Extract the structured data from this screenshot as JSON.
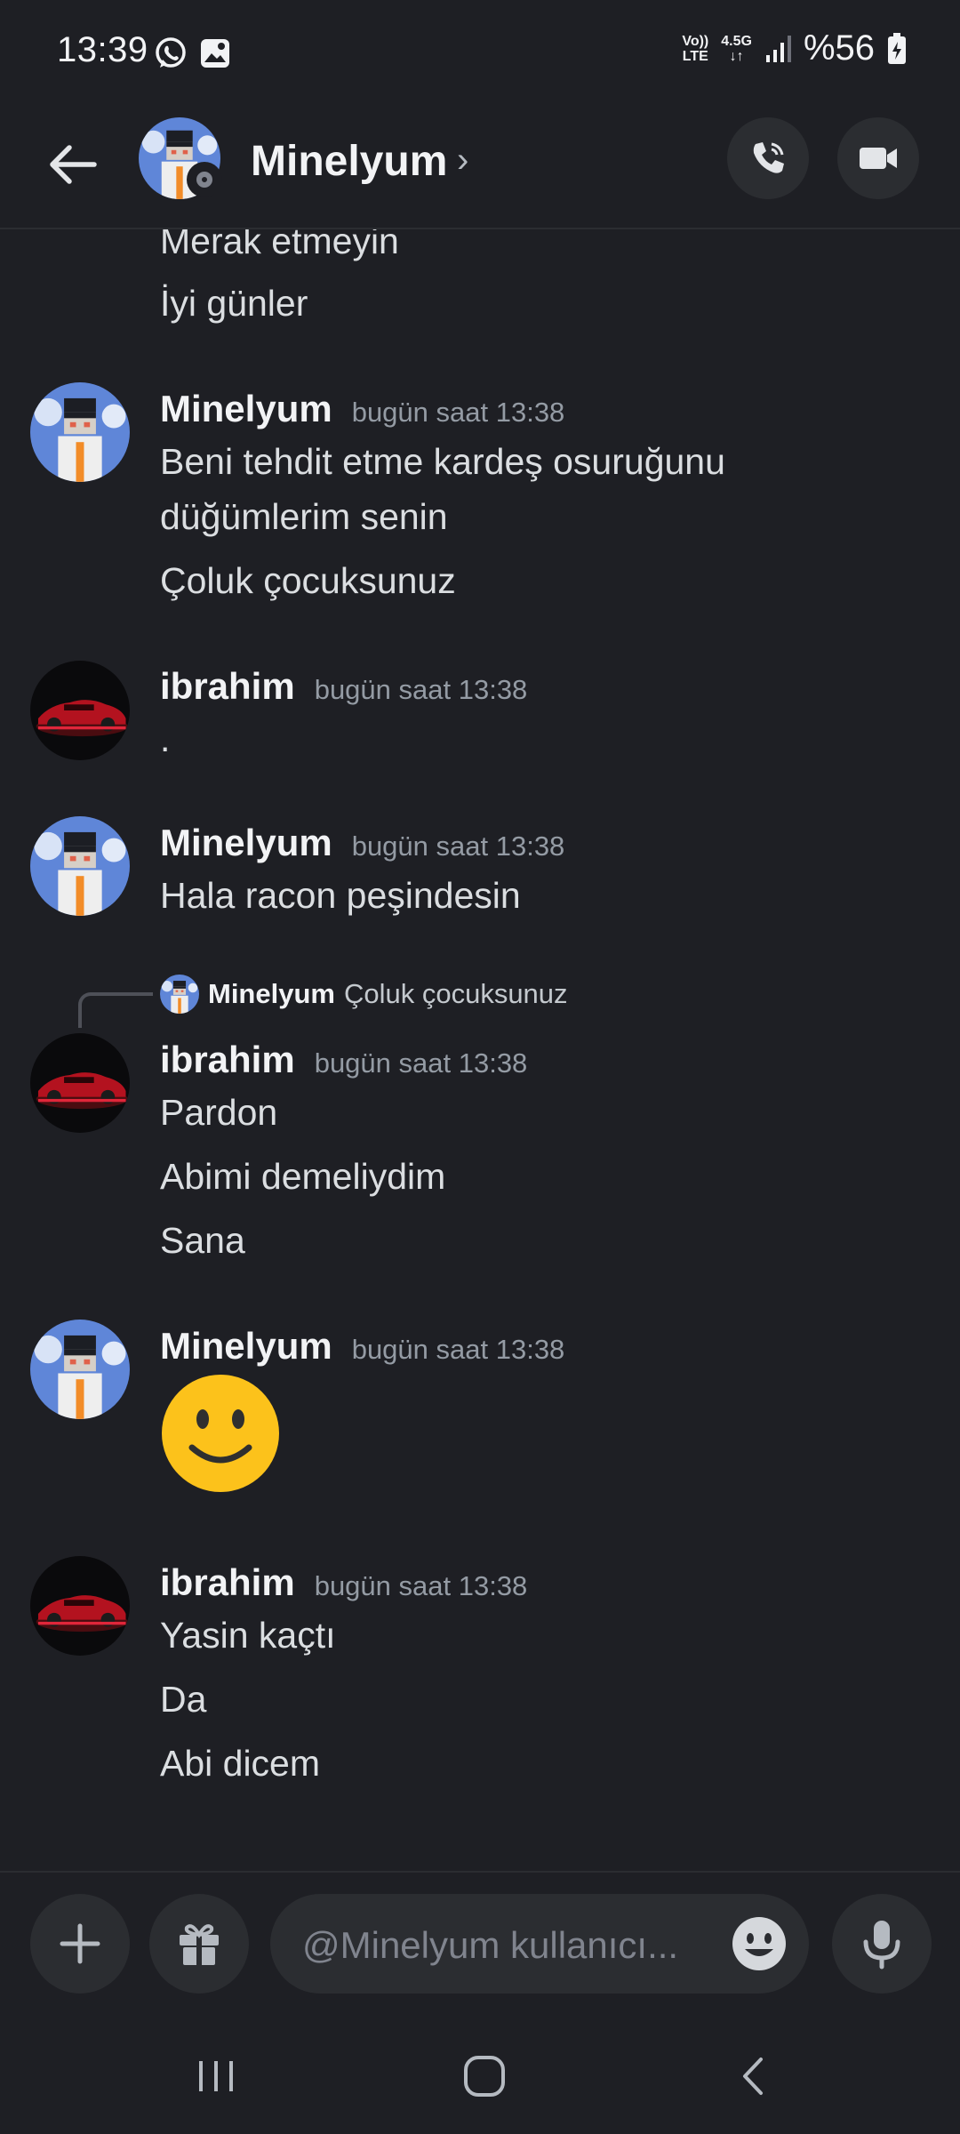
{
  "status_bar": {
    "time": "13:39",
    "icons": [
      "whatsapp-icon",
      "gallery-icon",
      "volte-icon",
      "signal-icon"
    ],
    "net_volte": "Vo))\nLTE",
    "net_type": "4.5G",
    "battery": "%56"
  },
  "header": {
    "name": "Minelyum",
    "chevron": "›",
    "icons": [
      "back-arrow-icon",
      "phone-icon",
      "video-camera-icon"
    ]
  },
  "messages": {
    "prev_line1": "Merak etmeyin",
    "prev_line2": "İyi günler",
    "g1": {
      "author": "Minelyum",
      "time": "bugün saat 13:38",
      "line1": "Beni tehdit etme kardeş osuruğunu",
      "line2": "düğümlerim senin",
      "line3": "Çoluk çocuksunuz"
    },
    "g2": {
      "author": "ibrahim",
      "time": "bugün saat 13:38",
      "line1": "."
    },
    "g3": {
      "author": "Minelyum",
      "time": "bugün saat 13:38",
      "line1": "Hala racon peşindesin"
    },
    "g4": {
      "reply_author": "Minelyum",
      "reply_text": "Çoluk çocuksunuz",
      "author": "ibrahim",
      "time": "bugün saat 13:38",
      "line1": "Pardon",
      "line2": "Abimi demeliydim",
      "line3": "Sana"
    },
    "g5": {
      "author": "Minelyum",
      "time": "bugün saat 13:38",
      "emoji": "slightly-smiling-face-emoji"
    },
    "g6": {
      "author": "ibrahim",
      "time": "bugün saat 13:38",
      "line1": "Yasin kaçtı",
      "line2": "Da",
      "line3": "Abi dicem"
    }
  },
  "composer": {
    "placeholder": "@Minelyum kullanıcı...",
    "icons": [
      "plus-icon",
      "gift-icon",
      "emoji-icon",
      "microphone-icon"
    ]
  },
  "nav_bar": {
    "icons": [
      "recent-apps-icon",
      "home-icon",
      "back-icon"
    ]
  },
  "colors": {
    "background": "#1e1f24",
    "surface": "#2b2d31",
    "text": "#dbdee1",
    "muted": "#949ba4",
    "emoji_yellow": "#fcc21b"
  }
}
